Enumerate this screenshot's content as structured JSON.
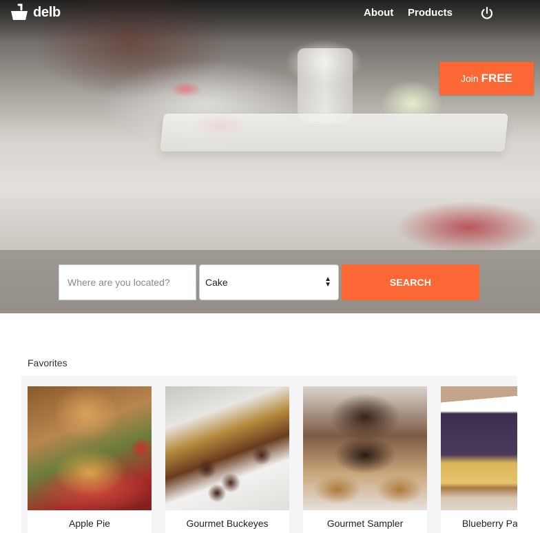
{
  "brand": {
    "name": "delb",
    "logo_icon": "basket-icon"
  },
  "nav": {
    "links": [
      {
        "label": "About"
      },
      {
        "label": "Products"
      }
    ],
    "power_icon": "power-icon"
  },
  "hero": {
    "join_prefix": "Join",
    "join_emphasis": "FREE"
  },
  "search": {
    "location_placeholder": "Where are you located?",
    "location_value": "",
    "category_selected": "Cake",
    "button_label": "SEARCH"
  },
  "favorites": {
    "title": "Favorites",
    "items": [
      {
        "name": "Apple Pie"
      },
      {
        "name": "Gourmet Buckeyes"
      },
      {
        "name": "Gourmet Sampler"
      },
      {
        "name": "Blueberry Pancake"
      }
    ]
  },
  "colors": {
    "accent": "#fb6835",
    "text": "#333333",
    "strip_bg": "#f5f5f5"
  }
}
